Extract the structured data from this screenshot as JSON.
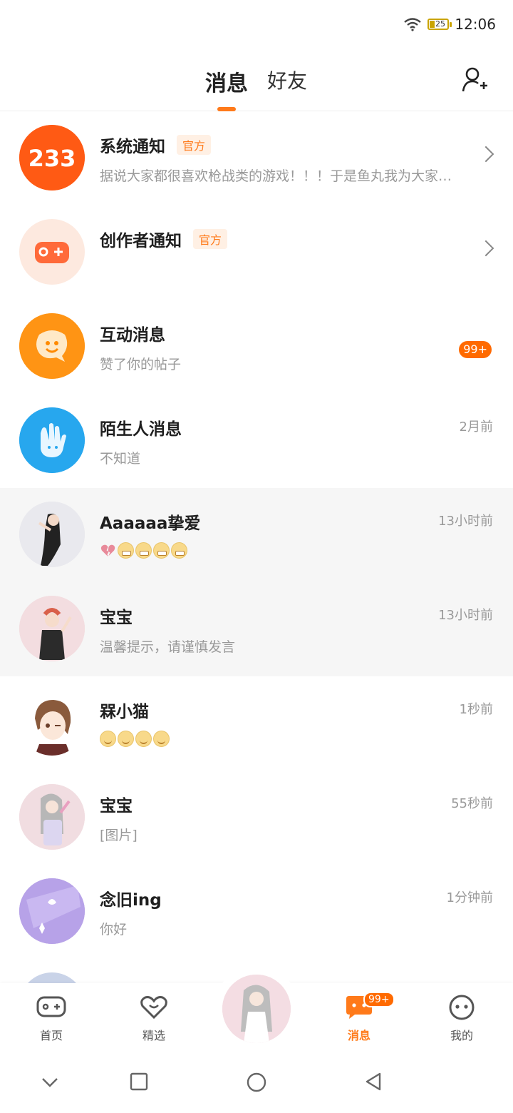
{
  "status": {
    "time": "12:06",
    "battery": "25"
  },
  "tabs": {
    "messages": "消息",
    "friends": "好友"
  },
  "rows": [
    {
      "title": "系统通知",
      "tag": "官方",
      "sub": "据说大家都很喜欢枪战类的游戏！！！于是鱼丸我为大家…",
      "avatar_text": "233"
    },
    {
      "title": "创作者通知",
      "tag": "官方"
    },
    {
      "title": "互动消息",
      "sub": "赞了你的帖子",
      "badge": "99+"
    },
    {
      "title": "陌生人消息",
      "sub": "不知道",
      "time": "2月前"
    },
    {
      "title": "Aaaaaa挚爱",
      "time": "13小时前"
    },
    {
      "title": "宝宝",
      "sub": "温馨提示，请谨慎发言",
      "time": "13小时前"
    },
    {
      "title": "槑小猫",
      "time": "1秒前"
    },
    {
      "title": "宝宝",
      "sub": "[图片]",
      "time": "55秒前"
    },
    {
      "title": "念旧ing",
      "sub": "你好",
      "time": "1分钟前"
    }
  ],
  "nav": {
    "home": "首页",
    "featured": "精选",
    "messages": "消息",
    "mine": "我的",
    "messages_badge": "99+"
  },
  "colors": {
    "accent": "#ff7a1a",
    "text": "#222222",
    "muted": "#999999"
  }
}
